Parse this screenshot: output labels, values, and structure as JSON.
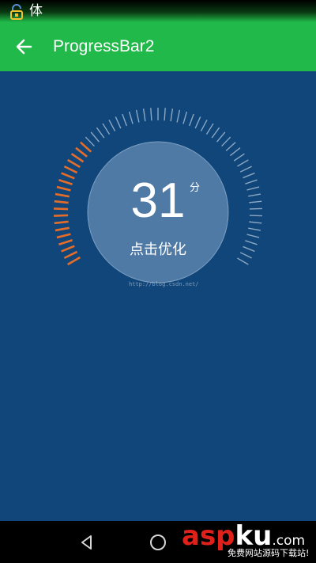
{
  "status_bar": {
    "text": "体",
    "icon": "lock-icon"
  },
  "app_bar": {
    "back_icon": "arrow-left-icon",
    "title": "ProgressBar2"
  },
  "gauge": {
    "score": "31",
    "unit": "分",
    "action_label": "点击优化",
    "progress_fraction": 0.31,
    "progress_color": "#e56d2a",
    "track_color": "#8aa7c4",
    "watermark": "http://blog.csdn.net/"
  },
  "nav_bar": {
    "back_icon": "nav-back-icon",
    "home_icon": "nav-home-icon"
  },
  "logo": {
    "part1": "asp",
    "part2": "ku",
    "part3": ".com",
    "subtitle": "免费网站源码下载站!"
  },
  "colors": {
    "app_bar": "#21b949",
    "background": "#11467a",
    "nav_bar": "#000000"
  }
}
